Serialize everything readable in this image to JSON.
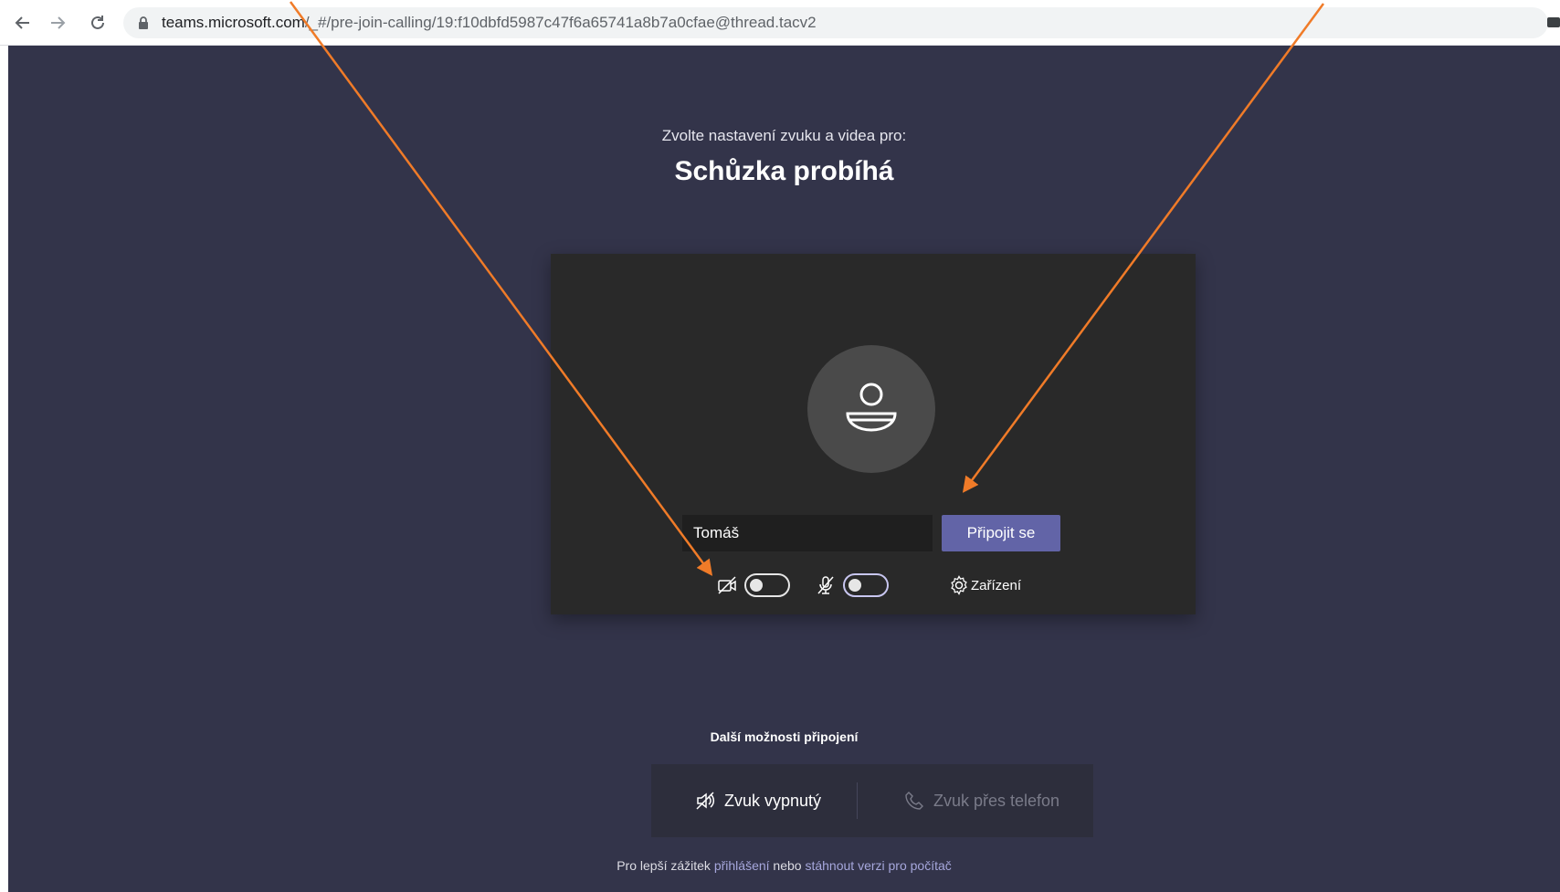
{
  "browser": {
    "url_host": "teams.microsoft.com",
    "url_path": "/_#/pre-join-calling/19:f10dbfd5987c47f6a65741a8b7a0cfae@thread.tacv2"
  },
  "prejoin": {
    "subtitle": "Zvolte nastavení zvuku a videa pro:",
    "meeting_title": "Schůzka probíhá",
    "name_value": "Tomáš",
    "join_label": "Připojit se",
    "devices_label": "Zařízení",
    "camera_on": false,
    "mic_on": false
  },
  "more_options": {
    "title": "Další možnosti připojení",
    "audio_off_label": "Zvuk vypnutý",
    "phone_audio_label": "Zvuk přes telefon"
  },
  "footer": {
    "prefix": "Pro lepší zážitek",
    "signin_link": "přihlášení",
    "middle": "nebo",
    "download_link": "stáhnout verzi pro počítač"
  },
  "colors": {
    "background": "#33344a",
    "preview_bg": "#292929",
    "accent": "#6264a7",
    "annotation_arrow": "#f07b28"
  }
}
